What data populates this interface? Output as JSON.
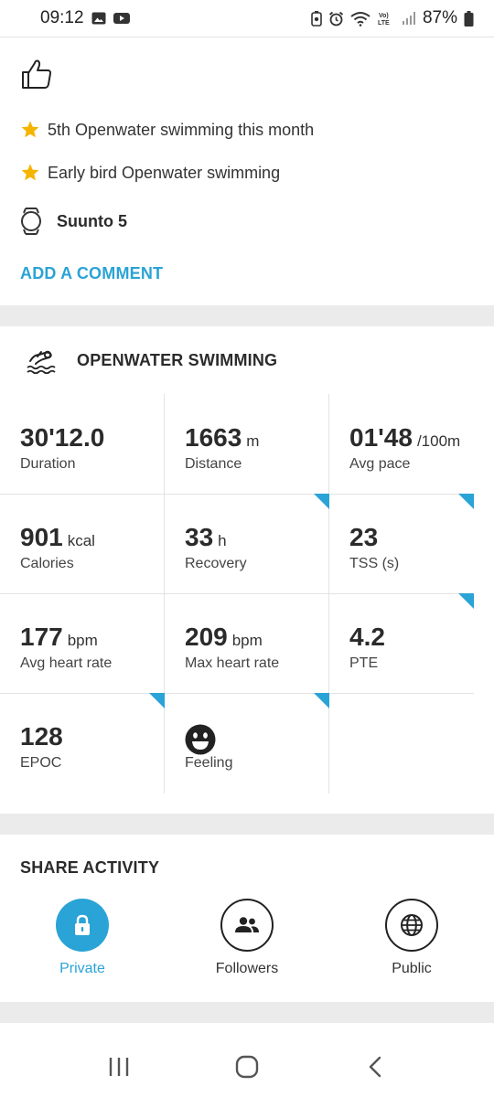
{
  "status_bar": {
    "time": "09:12",
    "battery": "87%",
    "icons": [
      "gallery-icon",
      "youtube-icon",
      "battery-saver-icon",
      "alarm-icon",
      "wifi-icon",
      "volte-icon",
      "signal-icon",
      "battery-icon"
    ]
  },
  "reactions": {
    "icon": "thumbs-up-icon"
  },
  "achievements": [
    {
      "icon": "star-icon",
      "text": "5th Openwater swimming this month"
    },
    {
      "icon": "star-icon",
      "text": "Early bird Openwater swimming"
    }
  ],
  "device": {
    "icon": "watch-icon",
    "name": "Suunto 5"
  },
  "add_comment": "ADD A COMMENT",
  "activity": {
    "icon": "openwater-swimming-icon",
    "title": "OPENWATER SWIMMING",
    "stats": [
      {
        "value": "30'12.0",
        "unit": "",
        "label": "Duration",
        "corner": false
      },
      {
        "value": "1663",
        "unit": "m",
        "label": "Distance",
        "corner": false
      },
      {
        "value": "01'48",
        "unit": "/100m",
        "label": "Avg pace",
        "corner": false
      },
      {
        "value": "901",
        "unit": "kcal",
        "label": "Calories",
        "corner": false
      },
      {
        "value": "33",
        "unit": "h",
        "label": "Recovery",
        "corner": true
      },
      {
        "value": "23",
        "unit": "",
        "label": "TSS (s)",
        "corner": true
      },
      {
        "value": "177",
        "unit": "bpm",
        "label": "Avg heart rate",
        "corner": false
      },
      {
        "value": "209",
        "unit": "bpm",
        "label": "Max heart rate",
        "corner": false
      },
      {
        "value": "4.2",
        "unit": "",
        "label": "PTE",
        "corner": true
      },
      {
        "value": "128",
        "unit": "",
        "label": "EPOC",
        "corner": true
      },
      {
        "value": "",
        "unit": "",
        "label": "Feeling",
        "corner": true,
        "icon": "happy-face-icon"
      }
    ]
  },
  "share": {
    "title": "SHARE ACTIVITY",
    "options": [
      {
        "label": "Private",
        "icon": "lock-icon",
        "selected": true
      },
      {
        "label": "Followers",
        "icon": "people-icon",
        "selected": false
      },
      {
        "label": "Public",
        "icon": "globe-icon",
        "selected": false
      }
    ],
    "accent": "#2aa3d6"
  },
  "nav": [
    "recents-icon",
    "home-icon",
    "back-icon"
  ]
}
